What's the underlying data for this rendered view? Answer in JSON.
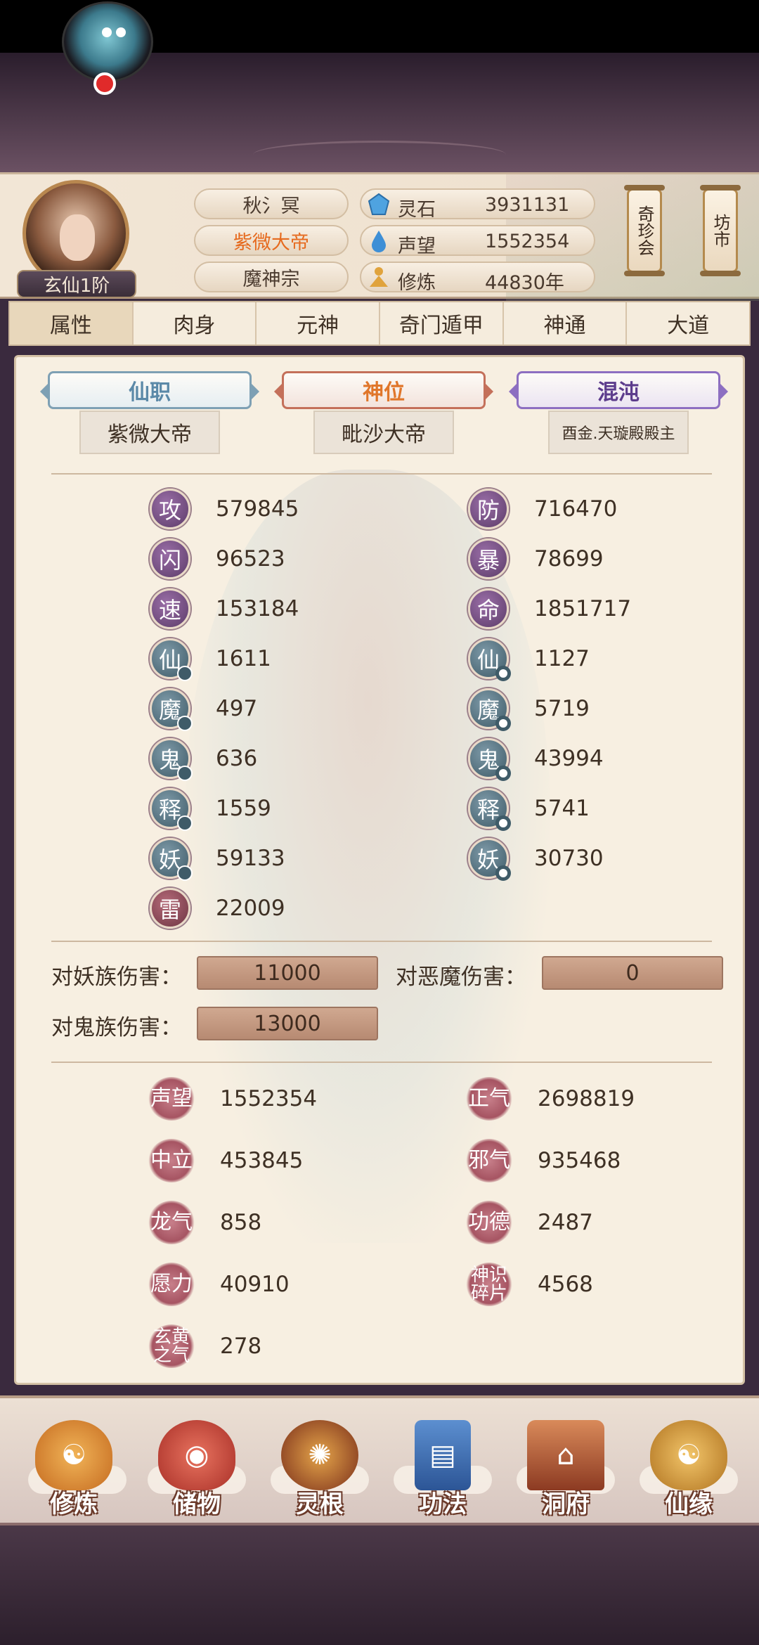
{
  "player": {
    "name": "秋氵冥",
    "title": "紫微大帝",
    "sect": "魔神宗",
    "rank": "玄仙1阶"
  },
  "resources": [
    {
      "label": "灵石",
      "value": "3931131",
      "icon": "spirit-stone-icon",
      "color": "#4fa3e0"
    },
    {
      "label": "声望",
      "value": "1552354",
      "icon": "reputation-drop-icon",
      "color": "#3e8fd6"
    },
    {
      "label": "修炼",
      "value": "44830年",
      "icon": "meditation-icon",
      "color": "#e0a33c"
    }
  ],
  "side_buttons": {
    "treasure": "奇珍会",
    "market": "坊市"
  },
  "tabs": [
    "属性",
    "肉身",
    "元神",
    "奇门遁甲",
    "神通",
    "大道"
  ],
  "titles": {
    "immortal_post": {
      "label": "仙职",
      "value": "紫微大帝"
    },
    "divine_rank": {
      "label": "神位",
      "value": "毗沙大帝"
    },
    "chaos": {
      "label": "混沌",
      "value": "酉金.天璇殿殿主"
    }
  },
  "stats_left": [
    {
      "icon": "攻",
      "value": "579845"
    },
    {
      "icon": "闪",
      "value": "96523"
    },
    {
      "icon": "速",
      "value": "153184"
    },
    {
      "icon": "仙",
      "value": "1611"
    },
    {
      "icon": "魔",
      "value": "497"
    },
    {
      "icon": "鬼",
      "value": "636"
    },
    {
      "icon": "释",
      "value": "1559"
    },
    {
      "icon": "妖",
      "value": "59133"
    },
    {
      "icon": "雷",
      "value": "22009"
    }
  ],
  "stats_right": [
    {
      "icon": "防",
      "value": "716470"
    },
    {
      "icon": "暴",
      "value": "78699"
    },
    {
      "icon": "命",
      "value": "1851717"
    },
    {
      "icon": "仙",
      "value": "1127"
    },
    {
      "icon": "魔",
      "value": "5719"
    },
    {
      "icon": "鬼",
      "value": "43994"
    },
    {
      "icon": "释",
      "value": "5741"
    },
    {
      "icon": "妖",
      "value": "30730"
    }
  ],
  "damage": {
    "vs_yao_label": "对妖族伤害：",
    "vs_yao": "11000",
    "vs_demon_label": "对恶魔伤害：",
    "vs_demon": "0",
    "vs_ghost_label": "对鬼族伤害：",
    "vs_ghost": "13000"
  },
  "reputation_left": [
    {
      "icon": "声望",
      "value": "1552354"
    },
    {
      "icon": "中立",
      "value": "453845"
    },
    {
      "icon": "龙气",
      "value": "858"
    },
    {
      "icon": "愿力",
      "value": "40910"
    },
    {
      "icon": "玄黄之气",
      "value": "278"
    }
  ],
  "reputation_right": [
    {
      "icon": "正气",
      "value": "2698819"
    },
    {
      "icon": "邪气",
      "value": "935468"
    },
    {
      "icon": "功德",
      "value": "2487"
    },
    {
      "icon": "神识碎片",
      "value": "4568"
    }
  ],
  "bottom_nav": [
    {
      "label": "修炼",
      "icon": "cultivate-icon",
      "color": "#d9852f"
    },
    {
      "label": "储物",
      "icon": "storage-bag-icon",
      "color": "#c8463e"
    },
    {
      "label": "灵根",
      "icon": "spirit-root-icon",
      "color": "#8a3a22"
    },
    {
      "label": "功法",
      "icon": "technique-book-icon",
      "color": "#3e6fb0"
    },
    {
      "label": "洞府",
      "icon": "cave-dwelling-icon",
      "color": "#b85c38"
    },
    {
      "label": "仙缘",
      "icon": "gourd-icon",
      "color": "#c88a3a"
    }
  ]
}
